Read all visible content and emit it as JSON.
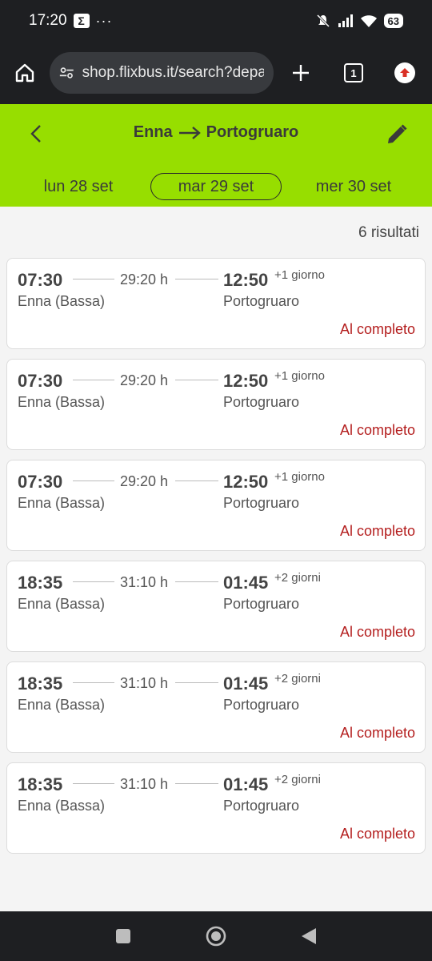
{
  "status_bar": {
    "time": "17:20",
    "badge": "Σ",
    "dots": "···",
    "battery": "63"
  },
  "browser": {
    "url": "shop.flixbus.it/search?departure",
    "tab_count": "1"
  },
  "header": {
    "origin": "Enna",
    "destination": "Portogruaro",
    "dates": {
      "prev": "lun 28 set",
      "current": "mar 29 set",
      "next": "mer 30 set"
    },
    "accent_color": "#97de00"
  },
  "results_count": "6 risultati",
  "trips": [
    {
      "departure_time": "07:30",
      "duration": "29:20 h",
      "arrival_time": "12:50",
      "day_offset": "+1 giorno",
      "departure_station": "Enna (Bassa)",
      "arrival_station": "Portogruaro",
      "status": "Al completo"
    },
    {
      "departure_time": "07:30",
      "duration": "29:20 h",
      "arrival_time": "12:50",
      "day_offset": "+1 giorno",
      "departure_station": "Enna (Bassa)",
      "arrival_station": "Portogruaro",
      "status": "Al completo"
    },
    {
      "departure_time": "07:30",
      "duration": "29:20 h",
      "arrival_time": "12:50",
      "day_offset": "+1 giorno",
      "departure_station": "Enna (Bassa)",
      "arrival_station": "Portogruaro",
      "status": "Al completo"
    },
    {
      "departure_time": "18:35",
      "duration": "31:10 h",
      "arrival_time": "01:45",
      "day_offset": "+2 giorni",
      "departure_station": "Enna (Bassa)",
      "arrival_station": "Portogruaro",
      "status": "Al completo"
    },
    {
      "departure_time": "18:35",
      "duration": "31:10 h",
      "arrival_time": "01:45",
      "day_offset": "+2 giorni",
      "departure_station": "Enna (Bassa)",
      "arrival_station": "Portogruaro",
      "status": "Al completo"
    },
    {
      "departure_time": "18:35",
      "duration": "31:10 h",
      "arrival_time": "01:45",
      "day_offset": "+2 giorni",
      "departure_station": "Enna (Bassa)",
      "arrival_station": "Portogruaro",
      "status": "Al completo"
    }
  ]
}
